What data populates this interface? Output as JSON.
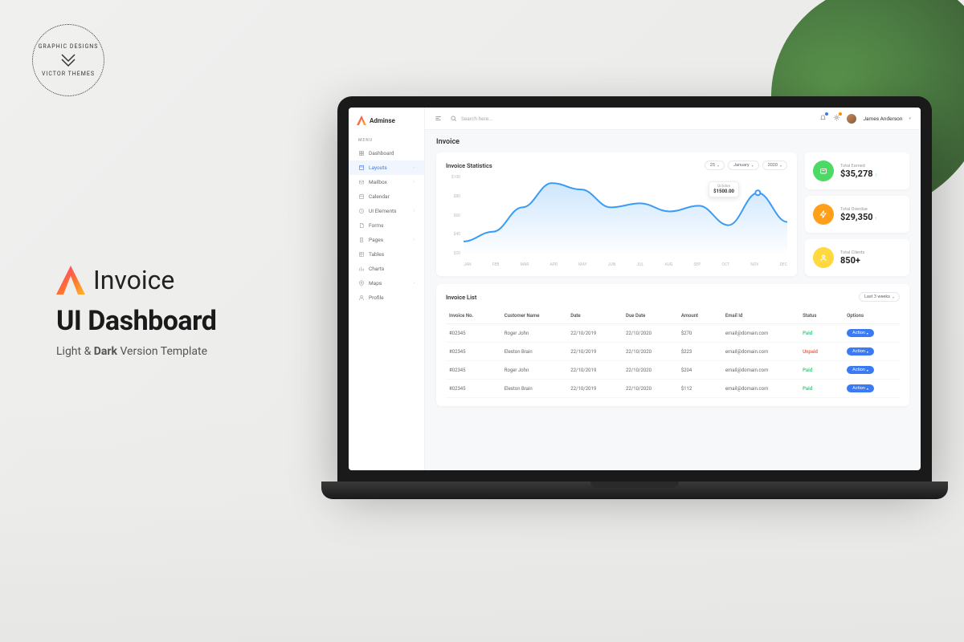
{
  "promo": {
    "title": "Invoice",
    "subtitle": "UI Dashboard",
    "tagline_pre": "Light & ",
    "tagline_bold": "Dark",
    "tagline_post": " Version Template",
    "badge_top": "GRAPHIC DESIGNS",
    "badge_bottom": "VICTOR THEMES"
  },
  "brand": {
    "name": "Adminse"
  },
  "menu_label": "MENU",
  "sidebar": {
    "items": [
      {
        "label": "Dashboard",
        "expand": false
      },
      {
        "label": "Layouts",
        "expand": true,
        "active": true
      },
      {
        "label": "Mailbox",
        "expand": true
      },
      {
        "label": "Calendar",
        "expand": false
      },
      {
        "label": "UI Elements",
        "expand": true
      },
      {
        "label": "Forms",
        "expand": false
      },
      {
        "label": "Pages",
        "expand": true
      },
      {
        "label": "Tables",
        "expand": false
      },
      {
        "label": "Charts",
        "expand": false
      },
      {
        "label": "Maps",
        "expand": true
      },
      {
        "label": "Profile",
        "expand": false
      }
    ]
  },
  "topbar": {
    "search_placeholder": "Search here...",
    "username": "James Anderson"
  },
  "page": {
    "title": "Invoice"
  },
  "chart": {
    "title": "Invoice Statistics",
    "filters": {
      "count": "25",
      "month": "January",
      "year": "2020"
    },
    "tooltip": {
      "month": "Octobre",
      "value": "$1500.00"
    }
  },
  "chart_data": {
    "type": "line",
    "title": "Invoice Statistics",
    "xlabel": "",
    "ylabel": "",
    "ylim": [
      0,
      100
    ],
    "y_ticks": [
      "$100",
      "$80",
      "$60",
      "$40",
      "$20"
    ],
    "categories": [
      "JAN",
      "FEB",
      "MAR",
      "APR",
      "MAY",
      "JUN",
      "JUL",
      "AUG",
      "SEP",
      "OCT",
      "NOV",
      "DEC"
    ],
    "values": [
      18,
      30,
      60,
      90,
      82,
      60,
      65,
      55,
      62,
      38,
      78,
      42
    ]
  },
  "stats": [
    {
      "label": "Total Earned",
      "value": "$35,278",
      "dir": "up",
      "color": "green"
    },
    {
      "label": "Total Overdue",
      "value": "$29,350",
      "dir": "up",
      "color": "orange"
    },
    {
      "label": "Total Clients",
      "value": "850+",
      "dir": "",
      "color": "yellow"
    }
  ],
  "list": {
    "title": "Invoice List",
    "filter": "Last 3 weeks",
    "columns": [
      "Invoice No.",
      "Customer Name",
      "Date",
      "Due Date",
      "Amount",
      "Email Id",
      "Status",
      "Options"
    ],
    "rows": [
      {
        "no": "#02345",
        "name": "Roger John",
        "date": "22/10/2019",
        "due": "22/10/2020",
        "amount": "$270",
        "email": "email@domain.com",
        "status": "Paid",
        "action": "Action"
      },
      {
        "no": "#02345",
        "name": "Eleston Brain",
        "date": "22/10/2019",
        "due": "22/10/2020",
        "amount": "$223",
        "email": "email@domain.com",
        "status": "Unpaid",
        "action": "Action"
      },
      {
        "no": "#02345",
        "name": "Roger John",
        "date": "22/10/2019",
        "due": "22/10/2020",
        "amount": "$204",
        "email": "email@domain.com",
        "status": "Paid",
        "action": "Action"
      },
      {
        "no": "#02345",
        "name": "Eleston Brain",
        "date": "22/10/2019",
        "due": "22/10/2020",
        "amount": "$112",
        "email": "email@domain.com",
        "status": "Paid",
        "action": "Action"
      }
    ]
  }
}
